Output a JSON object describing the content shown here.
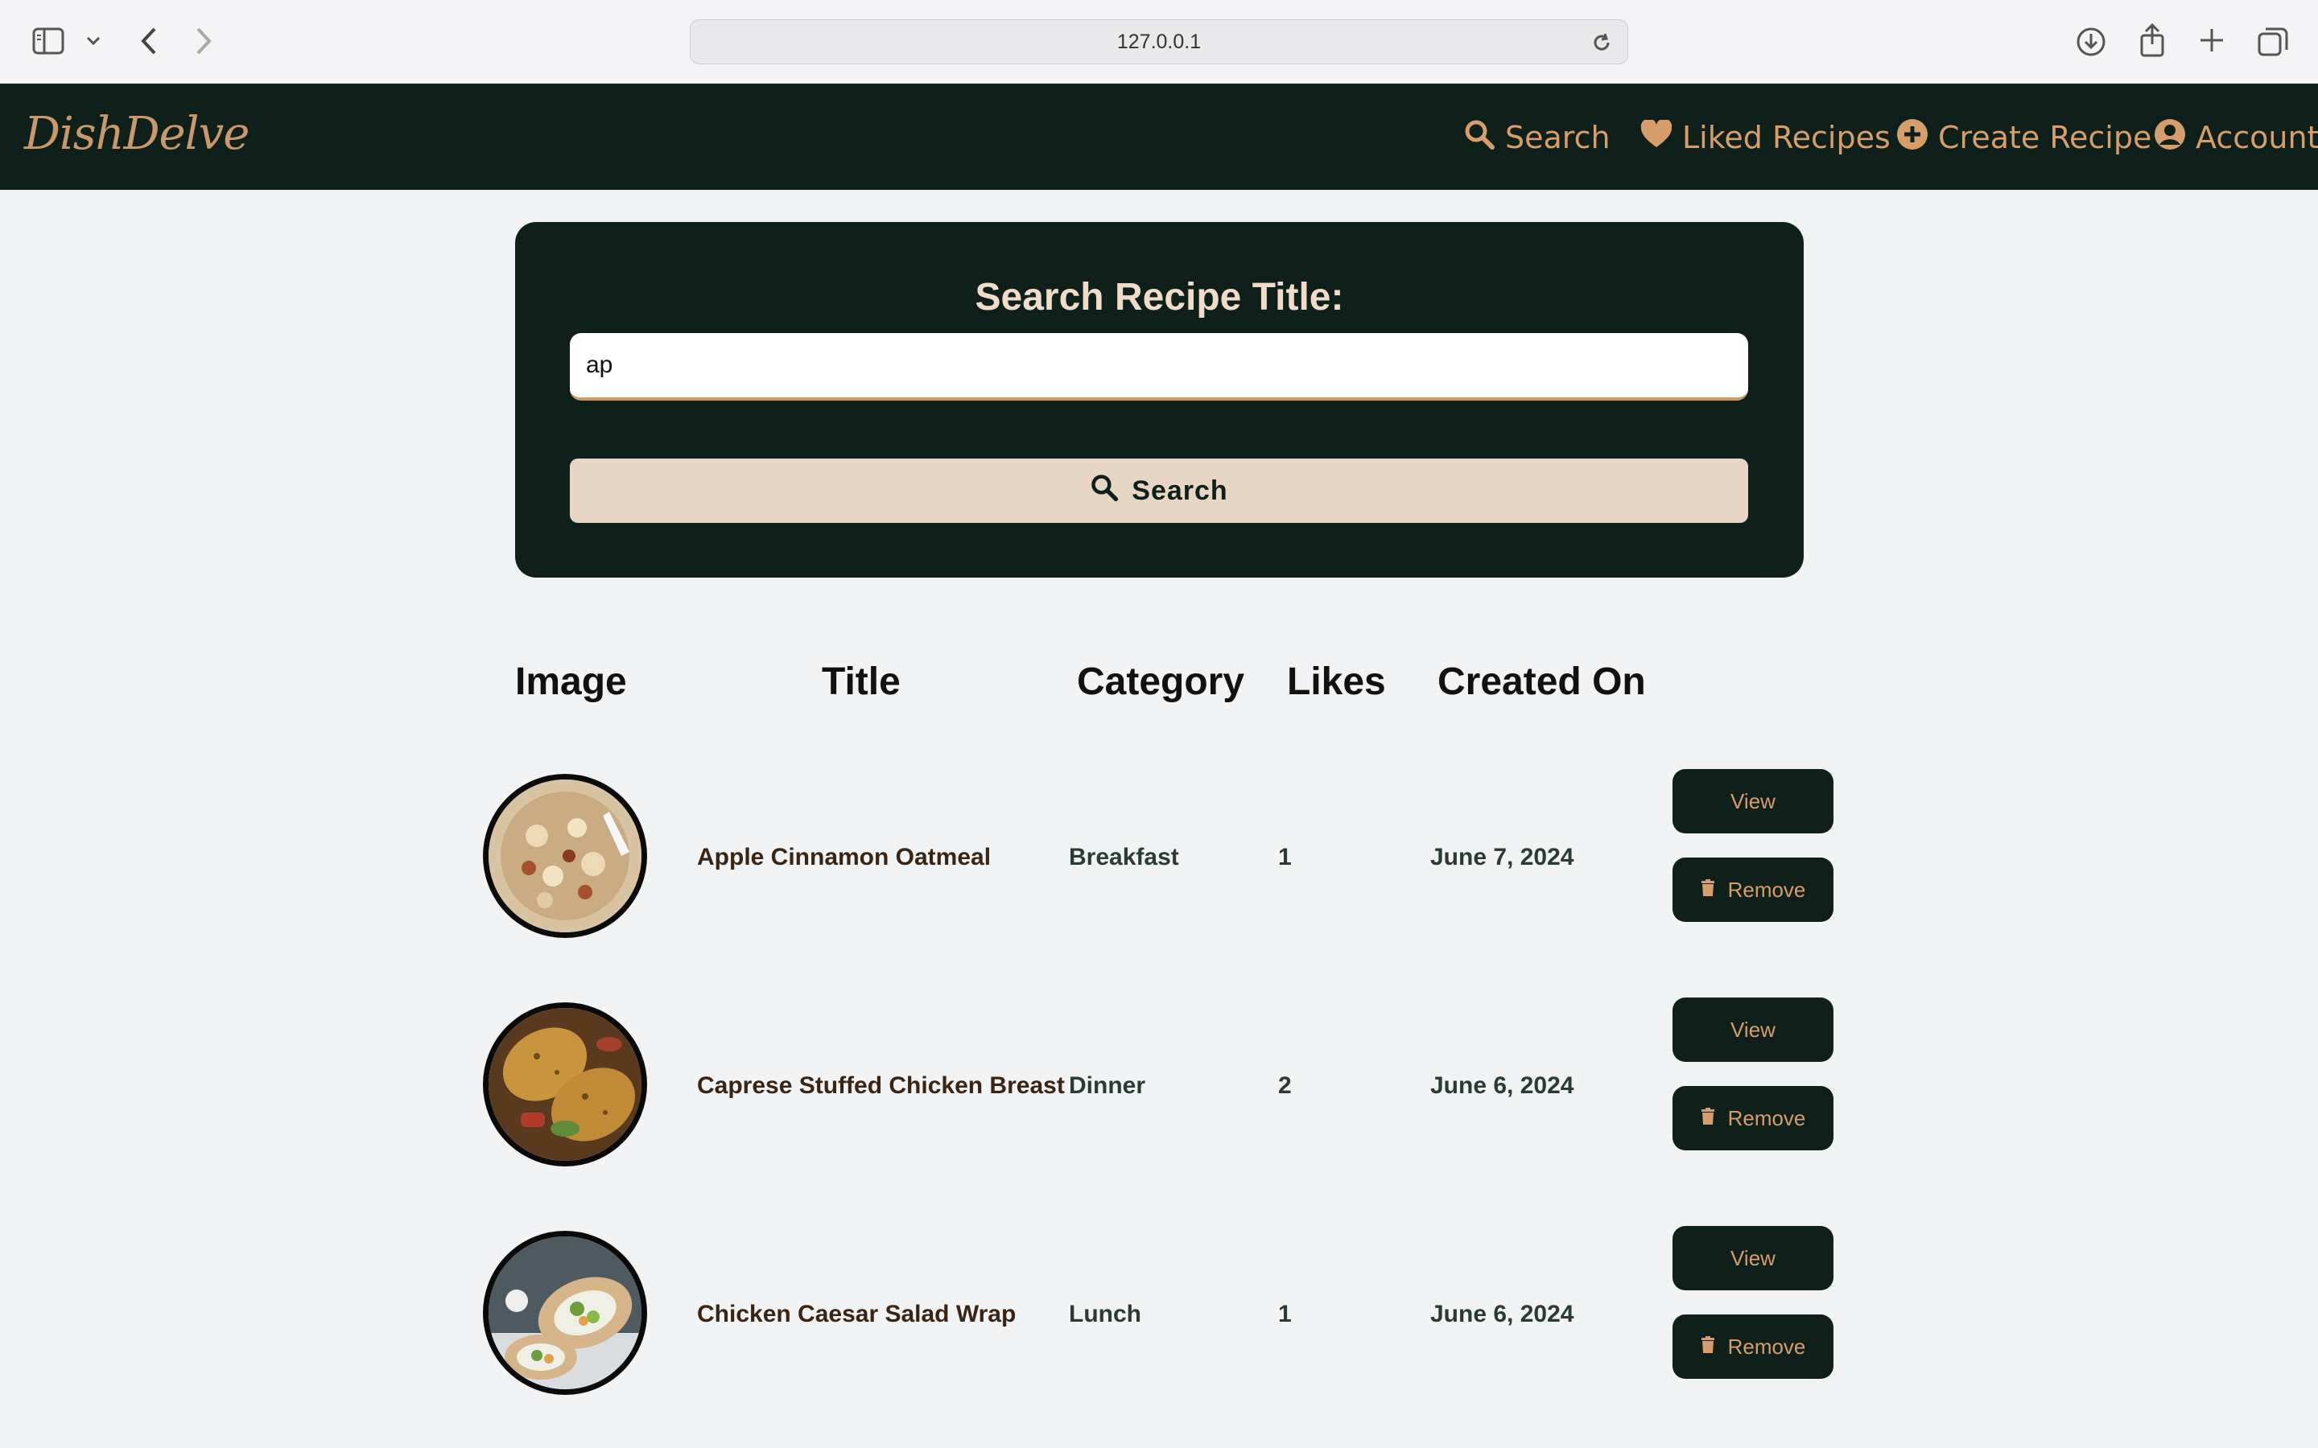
{
  "browser": {
    "url": "127.0.0.1"
  },
  "nav": {
    "logo": "DishDelve",
    "search": "Search",
    "liked": "Liked Recipes",
    "create": "Create Recipe",
    "account": "Account"
  },
  "search": {
    "title": "Search Recipe Title:",
    "value": "ap",
    "button": "Search"
  },
  "table": {
    "headers": {
      "image": "Image",
      "title": "Title",
      "category": "Category",
      "likes": "Likes",
      "created": "Created On"
    },
    "rows": [
      {
        "title": "Apple Cinnamon Oatmeal",
        "category": "Breakfast",
        "likes": "1",
        "created": "June 7, 2024",
        "image_icon": "oatmeal-photo"
      },
      {
        "title": "Caprese Stuffed Chicken Breast",
        "category": "Dinner",
        "likes": "2",
        "created": "June 6, 2024",
        "image_icon": "chicken-photo"
      },
      {
        "title": "Chicken Caesar Salad Wrap",
        "category": "Lunch",
        "likes": "1",
        "created": "June 6, 2024",
        "image_icon": "wrap-photo"
      }
    ],
    "view_label": "View",
    "remove_label": "Remove"
  },
  "colors": {
    "nav_bg": "#0f1f1a",
    "accent": "#d79d6a",
    "button_light": "#e8d6c5",
    "page_bg": "#f2f3f5"
  }
}
